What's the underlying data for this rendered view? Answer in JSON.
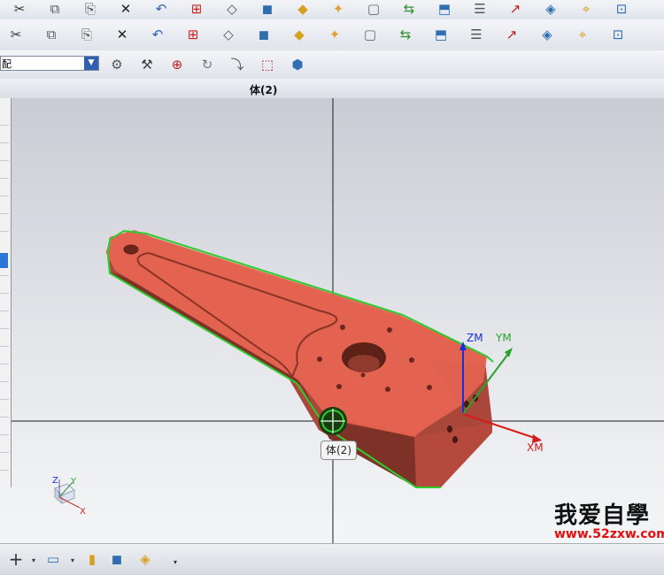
{
  "toolbar_top": {
    "icons": [
      "cut-icon",
      "copy-icon",
      "paste-icon",
      "delete-icon",
      "undo-icon",
      "snap-view-icon",
      "sketch-icon",
      "block-icon",
      "shade-icon",
      "render-icon",
      "box-icon",
      "move-icon",
      "extrude-icon",
      "table-icon",
      "axis-icon",
      "orient-icon",
      "measure-icon",
      "view-icon"
    ]
  },
  "toolbar_second": {
    "icons": [
      "part-nav-icon",
      "assembly-icon",
      "list-icon",
      "cmd-icon",
      "check-icon",
      "copy-part-icon",
      "edit-icon",
      "compare-icon",
      "replace-icon",
      "point-icon",
      "curve-icon",
      "snap-filter-icon",
      "layer-icon",
      "cross-icon",
      "orient-icon",
      "block-icon",
      "revolve-icon",
      "zoom-icon"
    ]
  },
  "toolbar_select": {
    "value": "配",
    "arrow": "▼"
  },
  "viewport_title": "体(2)",
  "selection_tooltip": "体(2)",
  "axes": {
    "zm": "ZM",
    "ym": "YM",
    "xm": "XM"
  },
  "triad": {
    "z": "Z",
    "y": "Y",
    "x": "X"
  },
  "watermark": {
    "text": "我爱自學",
    "url": "www.52zxw.com"
  },
  "colors": {
    "part": "#e05a4a",
    "part_dark": "#8b3a2e",
    "edge": "#2ecc2e",
    "z_axis": "#1a2fd8",
    "y_axis": "#28a428",
    "x_axis": "#d81c1c"
  }
}
